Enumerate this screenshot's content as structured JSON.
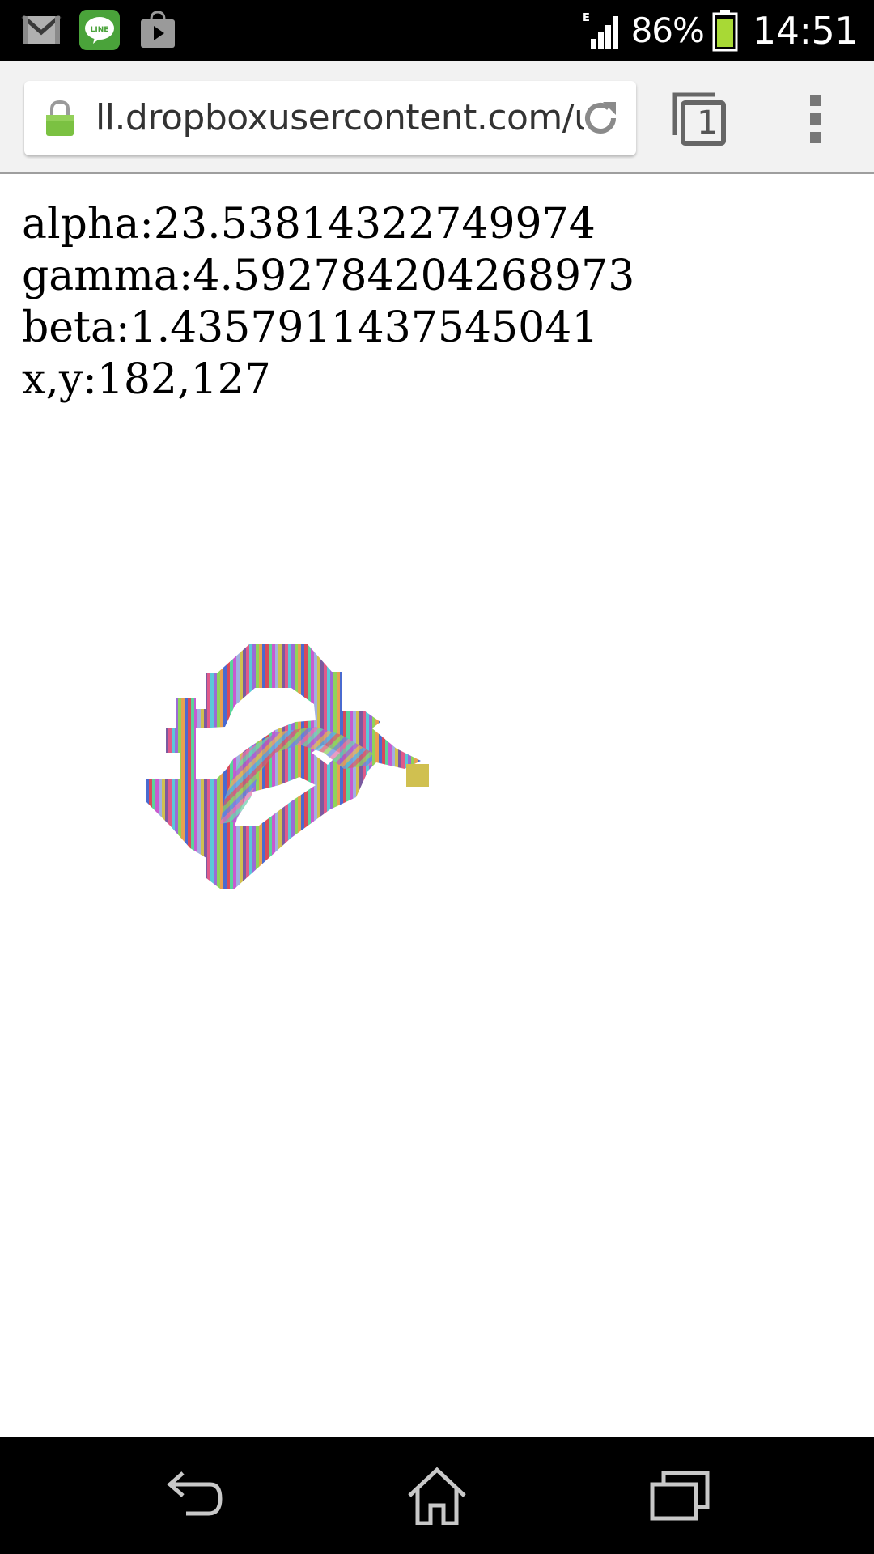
{
  "status_bar": {
    "notification_icons": [
      "gmail-icon",
      "line-app-icon",
      "play-store-icon"
    ],
    "network_type": "E",
    "battery_percent": "86%",
    "time": "14:51"
  },
  "browser": {
    "url": "ll.dropboxusercontent.com/u",
    "tab_count": "1",
    "icons": [
      "lock-icon",
      "reload-icon",
      "tabs-icon",
      "overflow-menu-icon"
    ]
  },
  "page": {
    "alpha": "alpha:23.53814322749974",
    "gamma": "gamma:4.592784204268973",
    "beta": "beta:1.4357911437545041",
    "xy": "x,y:182,127"
  },
  "nav_bar": {
    "icons": [
      "back-icon",
      "home-icon",
      "recents-icon"
    ]
  },
  "colors": {
    "status_bar_bg": "#000000",
    "toolbar_bg": "#f2f2f2",
    "lock_green": "#7bc142",
    "battery_green": "#a8d935"
  }
}
